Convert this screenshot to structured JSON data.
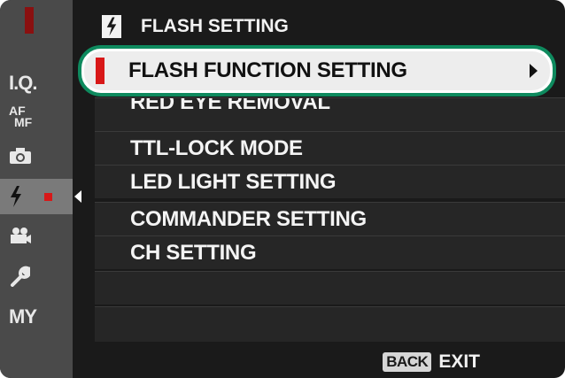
{
  "header": {
    "title": "FLASH SETTING",
    "icon": "flash-icon"
  },
  "sidebar": {
    "items": [
      {
        "label": "I.Q.",
        "icon": "image-quality-icon"
      },
      {
        "label_top": "AF",
        "label_bottom": "MF",
        "icon": "af-mf-icon"
      },
      {
        "label": "",
        "icon": "camera-icon"
      },
      {
        "label": "",
        "icon": "flash-icon",
        "active": true
      },
      {
        "label": "",
        "icon": "movie-icon"
      },
      {
        "label": "",
        "icon": "wrench-icon"
      },
      {
        "label": "MY",
        "icon": "my-menu-icon"
      }
    ]
  },
  "menu": {
    "selected": "FLASH FUNCTION SETTING",
    "items": [
      "RED EYE REMOVAL",
      "TTL-LOCK MODE",
      "LED LIGHT SETTING",
      "COMMANDER SETTING",
      "CH SETTING"
    ]
  },
  "footer": {
    "back": "BACK",
    "exit": "EXIT"
  },
  "colors": {
    "highlight_border": "#0e8a5e",
    "accent_red": "#d81818",
    "background": "#1a1a1a"
  }
}
